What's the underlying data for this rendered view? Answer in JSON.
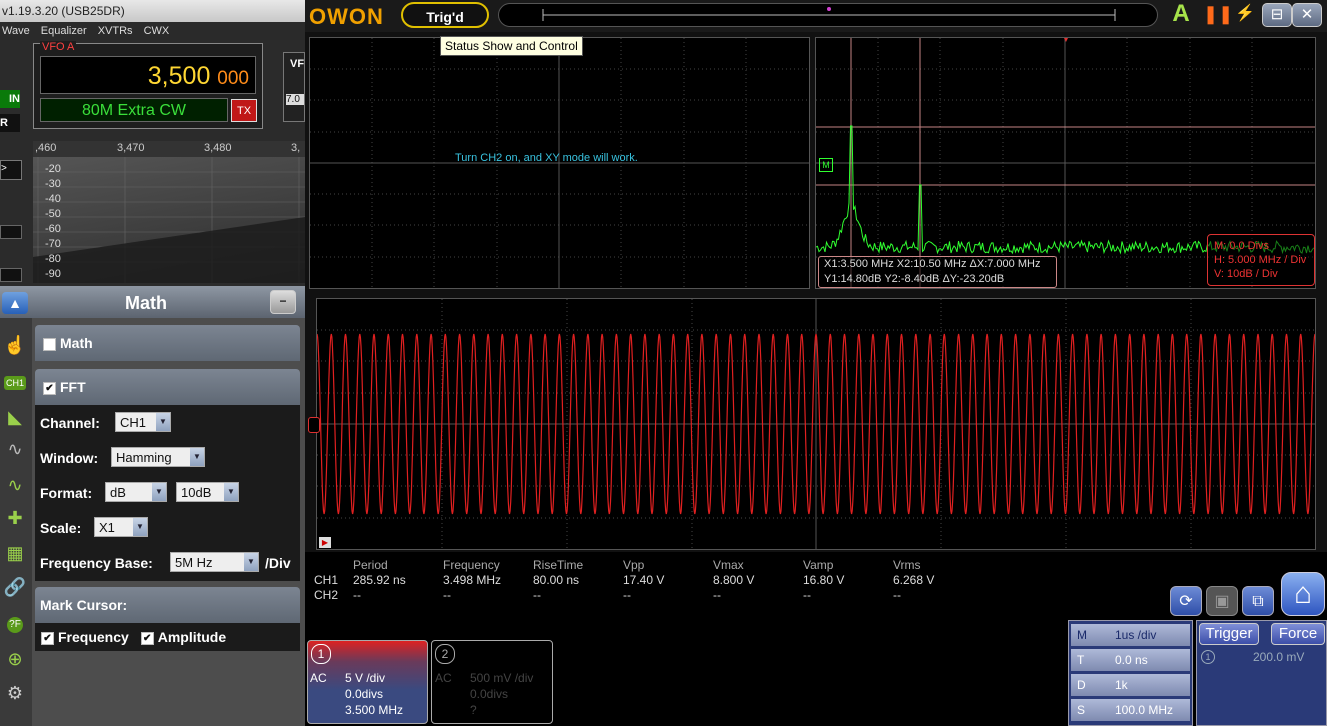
{
  "left_app": {
    "title": "v1.19.3.20 (USB25DR)",
    "menu": [
      "Wave",
      "Equalizer",
      "XVTRs",
      "CWX"
    ],
    "vfo": {
      "label": "VFO A",
      "freq_main": "3,500",
      "freq_small": "000",
      "mode": "80M Extra CW",
      "tx_label": "TX",
      "vfo_b_label": "VF",
      "vfo_b_freq": "7.0"
    },
    "side_stubs": [
      "IN",
      "R"
    ],
    "spectrum": {
      "ticks": [
        ",460",
        "3,470",
        "3,480",
        "3,"
      ],
      "db_labels": [
        "-20",
        "-30",
        "-40",
        "-50",
        "-60",
        "-70",
        "-80",
        "-90"
      ]
    }
  },
  "math_panel": {
    "title": "Math",
    "minimize": "−",
    "math_section": {
      "label": "Math",
      "checked": false
    },
    "fft_section": {
      "label": "FFT",
      "checked": true,
      "channel": {
        "label": "Channel:",
        "value": "CH1"
      },
      "window": {
        "label": "Window:",
        "value": "Hamming"
      },
      "format": {
        "label": "Format:",
        "value": "dB",
        "value2": "10dB"
      },
      "scale": {
        "label": "Scale:",
        "value": "X1"
      },
      "frequency_base": {
        "label": "Frequency Base:",
        "value": "5M Hz",
        "unit": "/Div"
      }
    },
    "mark_cursor": {
      "label": "Mark Cursor:",
      "frequency": {
        "label": "Frequency",
        "checked": true
      },
      "amplitude": {
        "label": "Amplitude",
        "checked": true
      }
    },
    "side_icons": [
      "ch1-icon",
      "waveform-icon",
      "cursor-icon",
      "measure-icon",
      "link-icon",
      "help-icon",
      "zoom-icon",
      "settings-icon"
    ],
    "side_icon_labels": {
      "ch1": "CH1",
      "help": "?F"
    }
  },
  "owon": {
    "logo": "OWON",
    "trig_status": "Trig'd",
    "tooltip": "Status Show and Control",
    "xy_message": "Turn  CH2  on, and XY mode will work.",
    "marker_m": "M",
    "fft_readout": {
      "line1": "X1:3.500 MHz X2:10.50 MHz ΔX:7.000 MHz",
      "line2": "Y1:14.80dB   Y2:-8.40dB    ΔY:-23.20dB"
    },
    "fft_settings": {
      "m": "M: 0.0 Divs",
      "h": "H: 5.000 MHz / Div",
      "v": "V: 10dB  / Div"
    },
    "waveform": {
      "cycles": 70,
      "amplitude_frac": 0.36,
      "color": "#e02020"
    },
    "fft_color": "#30ff30",
    "measurements": {
      "headers": [
        "",
        "Period",
        "Frequency",
        "RiseTime",
        "Vpp",
        "Vmax",
        "Vamp",
        "Vrms"
      ],
      "rows": [
        [
          "CH1",
          "285.92 ns",
          "3.498 MHz",
          "80.00 ns",
          "17.40 V",
          "8.800 V",
          "16.80 V",
          "6.268 V"
        ],
        [
          "CH2",
          "--",
          "--",
          "--",
          "--",
          "--",
          "--",
          "--"
        ]
      ]
    },
    "ch1": {
      "num": "1",
      "coupling": "AC",
      "volts": "5 V /div",
      "offset": "0.0divs",
      "freq": "3.500 MHz"
    },
    "ch2": {
      "num": "2",
      "coupling": "AC",
      "volts": "500 mV /div",
      "offset": "0.0divs",
      "freq": "?"
    },
    "timebase": {
      "rows": [
        {
          "key": "M",
          "value": "1us /div"
        },
        {
          "key": "T",
          "value": "0.0 ns"
        },
        {
          "key": "D",
          "value": "1k"
        },
        {
          "key": "S",
          "value": "100.0 MHz"
        }
      ]
    },
    "trigger": {
      "trigger_label": "Trigger",
      "force_label": "Force",
      "source": "1",
      "level": "200.0 mV"
    },
    "window_controls": {
      "auto": "A",
      "pause": "❚❚",
      "restore": "⊟",
      "close": "✕"
    }
  }
}
